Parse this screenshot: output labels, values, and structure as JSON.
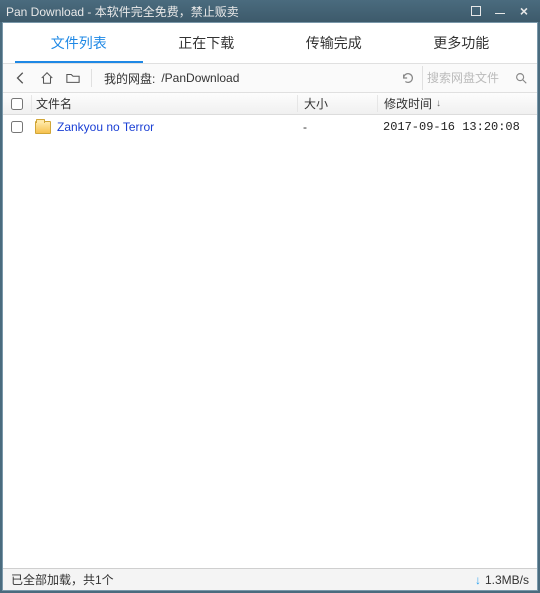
{
  "window": {
    "title": "Pan Download - 本软件完全免费，禁止贩卖"
  },
  "tabs": {
    "file_list": "文件列表",
    "downloading": "正在下载",
    "completed": "传输完成",
    "more": "更多功能"
  },
  "toolbar": {
    "path_label": "我的网盘:",
    "path_value": "/PanDownload",
    "search_placeholder": "搜索网盘文件"
  },
  "columns": {
    "name": "文件名",
    "size": "大小",
    "mtime": "修改时间"
  },
  "rows": [
    {
      "name": "Zankyou no Terror",
      "size": "-",
      "mtime": "2017-09-16 13:20:08"
    }
  ],
  "status": {
    "text": "已全部加载，共1个",
    "speed": "1.3MB/s"
  }
}
